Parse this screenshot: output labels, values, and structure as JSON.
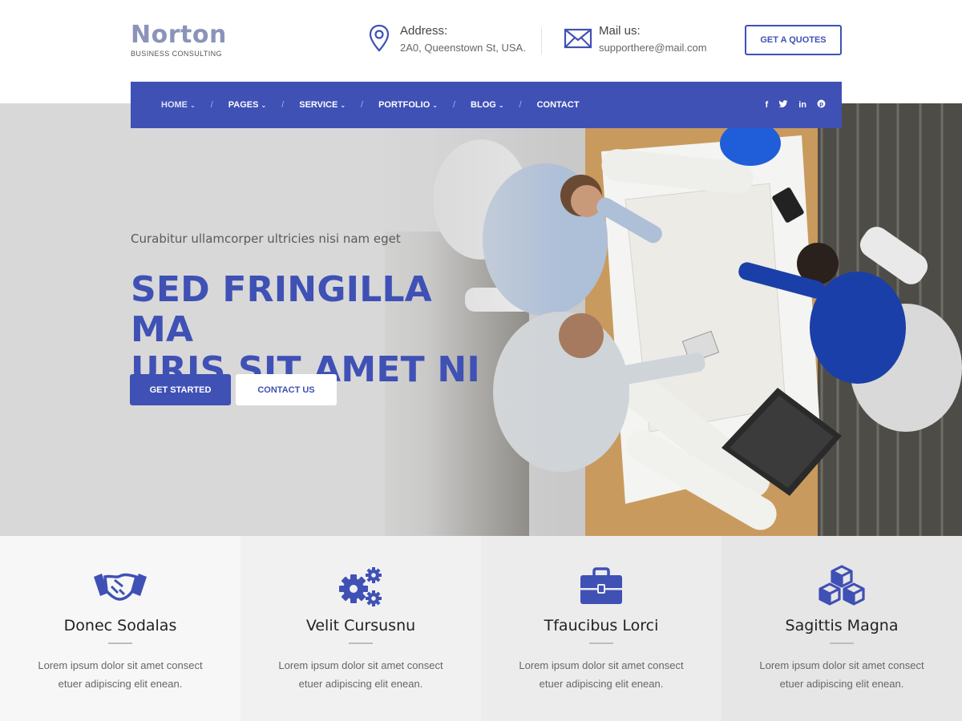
{
  "brand": {
    "name": "Norton",
    "tagline": "BUSINESS CONSULTING"
  },
  "contact": {
    "address_label": "Address:",
    "address_value": "2A0, Queenstown St, USA.",
    "mail_label": "Mail us:",
    "mail_value": "supporthere@mail.com"
  },
  "quote_button": "GET A QUOTES",
  "nav": {
    "items": [
      {
        "label": "HOME",
        "dropdown": true,
        "active": true
      },
      {
        "label": "PAGES",
        "dropdown": true
      },
      {
        "label": "SERVICE",
        "dropdown": true
      },
      {
        "label": "PORTFOLIO",
        "dropdown": true
      },
      {
        "label": "BLOG",
        "dropdown": true
      },
      {
        "label": "CONTACT",
        "dropdown": false
      }
    ],
    "separator": "/",
    "caret": "⌄",
    "social": [
      "f",
      "t",
      "in",
      "p"
    ]
  },
  "hero": {
    "subtitle": "Curabitur ullamcorper ultricies nisi nam eget",
    "title_line1": "SED FRINGILLA MA",
    "title_line2": "URIS SIT AMET NI",
    "primary_button": "GET STARTED",
    "secondary_button": "CONTACT US"
  },
  "features": [
    {
      "icon": "handshake-icon",
      "title": "Donec Sodalas",
      "text_line1": "Lorem ipsum dolor sit amet consect",
      "text_line2": "etuer adipiscing elit enean.",
      "bg": "#f7f7f7"
    },
    {
      "icon": "gears-icon",
      "title": "Velit Cursusnu",
      "text_line1": "Lorem ipsum dolor sit amet consect",
      "text_line2": "etuer adipiscing elit enean.",
      "bg": "#f1f1f1"
    },
    {
      "icon": "briefcase-icon",
      "title": "Tfaucibus Lorci",
      "text_line1": "Lorem ipsum dolor sit amet consect",
      "text_line2": "etuer adipiscing elit enean.",
      "bg": "#ececec"
    },
    {
      "icon": "cubes-icon",
      "title": "Sagittis Magna",
      "text_line1": "Lorem ipsum dolor sit amet consect",
      "text_line2": "etuer adipiscing elit enean.",
      "bg": "#e6e6e6"
    }
  ],
  "colors": {
    "accent": "#3f51b5",
    "logo": "#8b94b8",
    "hero_bg": "#d8d8d8"
  }
}
